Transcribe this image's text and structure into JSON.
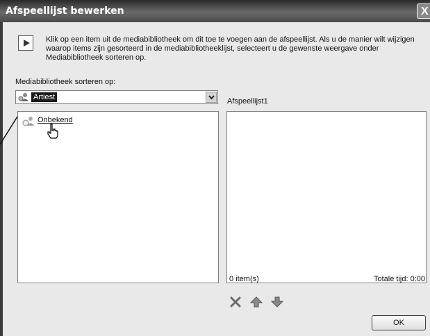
{
  "window": {
    "title": "Afspeellijst bewerken",
    "close_glyph": "X"
  },
  "info": {
    "icon": "play-icon",
    "text": "Klik op een item uit de mediabibliotheek om dit toe te voegen aan de afspeellijst. Als u de manier wilt wijzigen waarop items zijn gesorteerd in de mediabibliotheeklijst, selecteert u de gewenste weergave onder Mediabibliotheek sorteren op."
  },
  "sort": {
    "label": "Mediabibliotheek sorteren op:",
    "selected": "Artiest"
  },
  "library": {
    "items": [
      {
        "label": "Onbekend",
        "icon": "artist-icon"
      }
    ]
  },
  "playlist": {
    "name": "Afspeellijst1",
    "count": "0 item(s)",
    "total_time": "Totale tijd: 0:00"
  },
  "actions": {
    "delete_icon": "x-icon",
    "up_icon": "arrow-up-icon",
    "down_icon": "arrow-down-icon"
  },
  "buttons": {
    "ok": "OK"
  }
}
